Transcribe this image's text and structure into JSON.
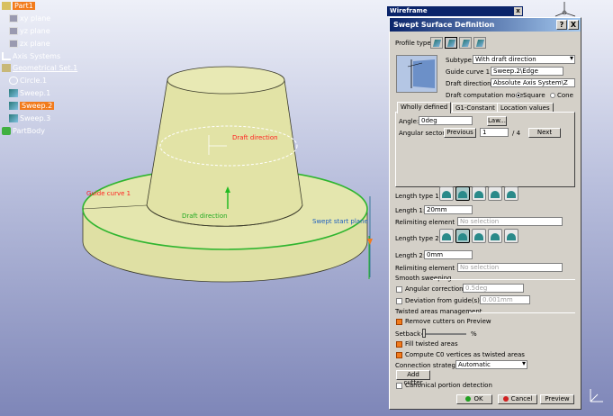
{
  "tree": {
    "items": [
      {
        "label": "Part1",
        "icon": "part-icon",
        "highlighted": true
      },
      {
        "label": "xy plane",
        "icon": "plane-icon"
      },
      {
        "label": "yz plane",
        "icon": "plane-icon"
      },
      {
        "label": "zx plane",
        "icon": "plane-icon"
      },
      {
        "label": "Axis Systems",
        "icon": "axis-system-icon"
      },
      {
        "label": "Geometrical Set.1",
        "icon": "geometrical-set-icon",
        "underlined": true
      },
      {
        "label": "Circle.1",
        "icon": "circle-icon"
      },
      {
        "label": "Sweep.1",
        "icon": "sweep-icon"
      },
      {
        "label": "Sweep.2",
        "icon": "sweep-icon",
        "highlighted": true
      },
      {
        "label": "Sweep.3",
        "icon": "sweep-icon"
      },
      {
        "label": "PartBody",
        "icon": "partbody-icon"
      }
    ]
  },
  "viewport": {
    "labels": {
      "draft_direction_top": "Draft direction",
      "guide_curve": "Guide curve 1",
      "draft_direction_mid": "Draft direction",
      "swept_start_plane": "Swept start plane"
    },
    "colors": {
      "model_fill": "#e4e6ae",
      "highlight": "#33cc33",
      "label_red": "#ff2020"
    }
  },
  "wireframe_toolbar": {
    "title": "Wireframe",
    "close": "x"
  },
  "dialog": {
    "title": "Swept Surface Definition",
    "help": "?",
    "close": "X",
    "profile_type_label": "Profile type:",
    "subtype_label": "Subtype:",
    "subtype_value": "With draft direction",
    "guide_curve_label": "Guide curve 1:",
    "guide_curve_value": "Sweep.2\\Edge",
    "draft_direction_label": "Draft direction:",
    "draft_direction_value": "Absolute Axis System\\Z",
    "draft_mode_label": "Draft computation mode:",
    "mode_square": "Square",
    "mode_cone": "Cone",
    "tabs": [
      "Wholly defined",
      "G1-Constant",
      "Location values"
    ],
    "angle_label": "Angle:",
    "angle_value": "0deg",
    "law_button": "Law...",
    "angular_sector_label": "Angular sector:",
    "previous_button": "Previous",
    "sector_value": "1",
    "sector_total": "/ 4",
    "next_button": "Next",
    "length_type_1_label": "Length type 1:",
    "length_1_label": "Length 1:",
    "length_1_value": "20mm",
    "relimiting_1_label": "Relimiting element 1:",
    "relimiting_1_placeholder": "No selection",
    "length_type_2_label": "Length type 2:",
    "length_2_label": "Length 2:",
    "length_2_value": "0mm",
    "relimiting_2_label": "Relimiting element 2:",
    "relimiting_2_placeholder": "No selection",
    "smooth_sweeping_label": "Smooth sweeping",
    "angular_correction_label": "Angular correction:",
    "angular_correction_value": "0.5deg",
    "deviation_label": "Deviation from guide(s):",
    "deviation_value": "0.001mm",
    "twisted_label": "Twisted areas management",
    "remove_cutters_label": "Remove cutters on Preview",
    "setback_label": "Setback",
    "setback_unit": "%",
    "fill_twisted_label": "Fill twisted areas",
    "compute_c0_label": "Compute C0 vertices as twisted areas",
    "connection_label": "Connection strategy:",
    "connection_value": "Automatic",
    "add_cutter_button": "Add cutter",
    "canonical_label": "Canonical portion detection",
    "ok_button": "OK",
    "cancel_button": "Cancel",
    "preview_button": "Preview"
  },
  "compass": {
    "x": "x",
    "y": "y",
    "z": "z"
  }
}
